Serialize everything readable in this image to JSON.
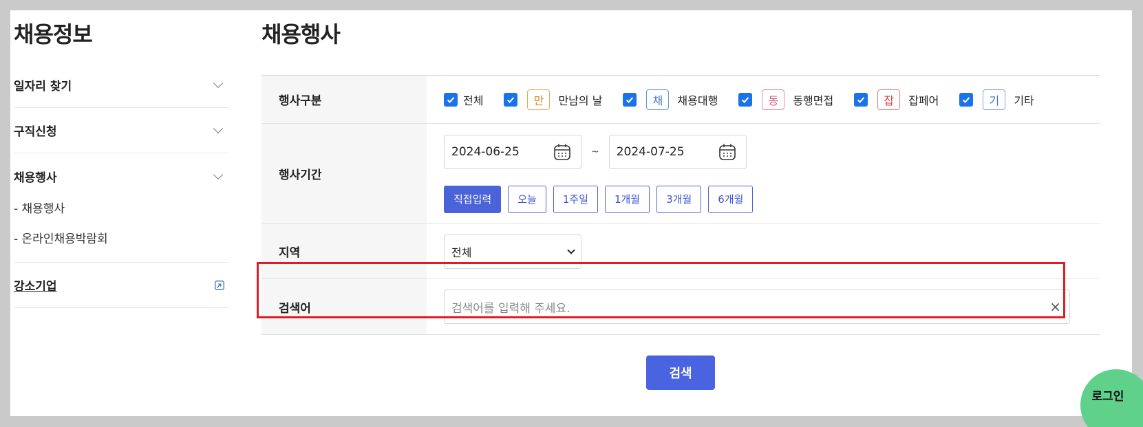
{
  "sidebar": {
    "title": "채용정보",
    "sections": [
      {
        "label": "일자리 찾기"
      },
      {
        "label": "구직신청"
      },
      {
        "label": "채용행사"
      }
    ],
    "sub_items": [
      "- 채용행사",
      "- 온라인채용박람회"
    ],
    "link": "강소기업"
  },
  "main": {
    "title": "채용행사",
    "type_row": {
      "label": "행사구분",
      "options": [
        {
          "tag": "",
          "label": "전체",
          "checked": true
        },
        {
          "tag": "만",
          "label": "만남의 날",
          "checked": true
        },
        {
          "tag": "채",
          "label": "채용대행",
          "checked": true
        },
        {
          "tag": "동",
          "label": "동행면접",
          "checked": true
        },
        {
          "tag": "잡",
          "label": "잡페어",
          "checked": true
        },
        {
          "tag": "기",
          "label": "기타",
          "checked": true
        }
      ]
    },
    "period_row": {
      "label": "행사기간",
      "start_date": "2024-06-25",
      "separator": "~",
      "end_date": "2024-07-25",
      "quick": [
        "직접입력",
        "오늘",
        "1주일",
        "1개월",
        "3개월",
        "6개월"
      ],
      "active_quick": "직접입력"
    },
    "region_row": {
      "label": "지역",
      "selected": "전체"
    },
    "search_row": {
      "label": "검색어",
      "value": "",
      "placeholder": "검색어를 입력해 주세요.",
      "clear": "×"
    },
    "submit_label": "검색"
  },
  "floating": {
    "login_label": "로그인"
  },
  "colors": {
    "primary": "#4a63e0",
    "highlight": "#e01b24",
    "login": "#5fd18a",
    "checkbox": "#1a73e8"
  }
}
